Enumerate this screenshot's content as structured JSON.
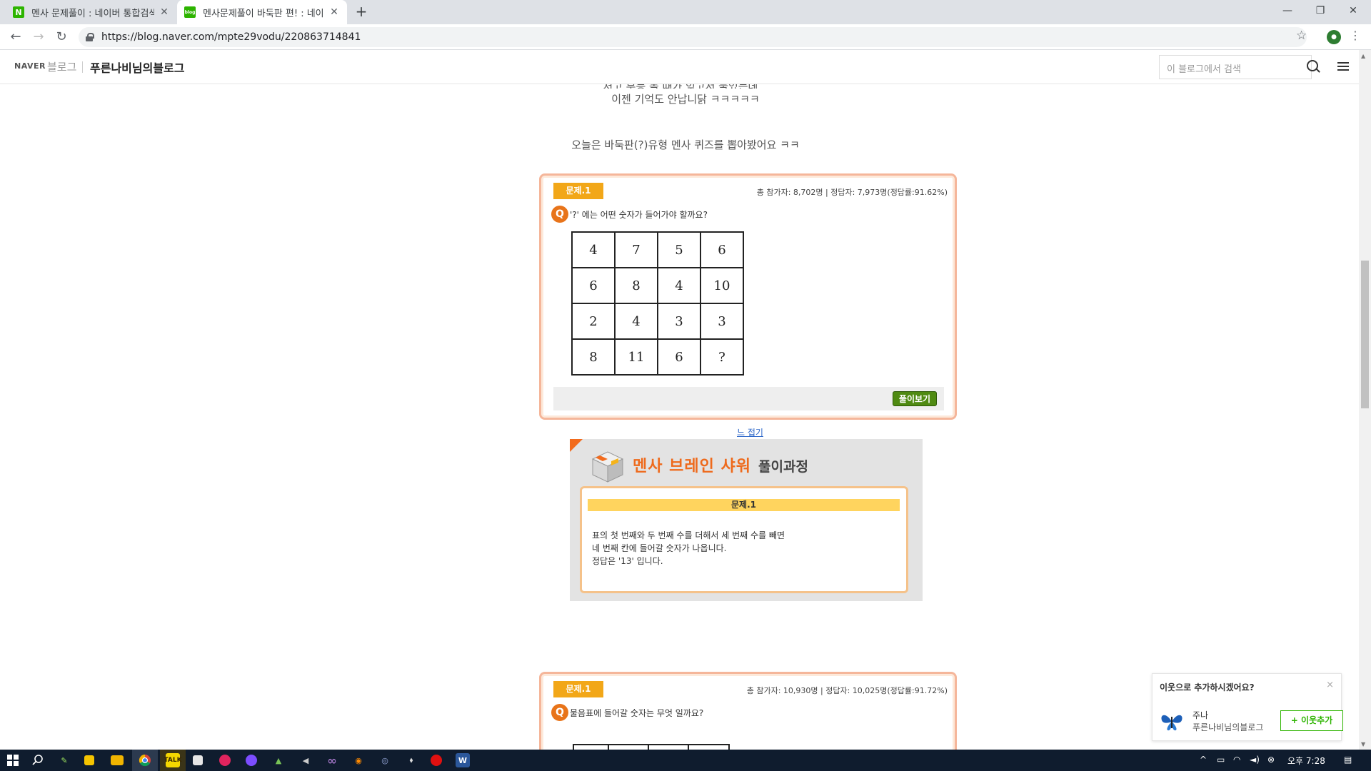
{
  "browser": {
    "tabs": [
      {
        "title": "멘사 문제풀이 : 네이버 통합검색"
      },
      {
        "title": "멘사문제풀이 바둑판 편! : 네이버"
      }
    ],
    "url": "https://blog.naver.com/mpte29vodu/220863714841"
  },
  "blog": {
    "naver": "NAVER",
    "blog_word": "블로그",
    "name": "푸른나비님의블로그",
    "search_placeholder": "이 블로그에서 검색"
  },
  "content": {
    "line_top_partial": "처고 무등 볼 때가 잊고서 불었는데...",
    "line_top2": "이젠 기억도 안납니닭 ㅋㅋㅋㅋㅋ",
    "intro": "오늘은 바둑판(?)유형 멘사 퀴즈를 뽑아봤어요 ㅋㅋ",
    "fold_link": "느 접기"
  },
  "quiz1": {
    "label": "문제.1",
    "stats": "총 참가자: 8,702명 | 정답자: 7,973명(정답률:91.62%)",
    "q_icon": "Q",
    "question": "'?' 에는 어떤 숫자가 들어가야 할까요?",
    "grid": [
      [
        "4",
        "7",
        "5",
        "6"
      ],
      [
        "6",
        "8",
        "4",
        "10"
      ],
      [
        "2",
        "4",
        "3",
        "3"
      ],
      [
        "8",
        "11",
        "6",
        "?"
      ]
    ],
    "answer_button": "풀이보기"
  },
  "solution": {
    "title": "멘사 브레인 샤워",
    "subtitle": "풀이과정",
    "header": "문제.1",
    "lines": [
      "표의 첫 번째와 두 번째 수를 더해서 세 번째 수를 빼면",
      "네 번째 칸에 들어갈 숫자가 나옵니다.",
      "정답은 '13' 입니다."
    ]
  },
  "quiz2": {
    "label": "문제.1",
    "stats": "총 참가자: 10,930명 | 정답자: 10,025명(정답률:91.72%)",
    "q_icon": "Q",
    "question": "물음표에 들어갈 숫자는 무엇 일까요?"
  },
  "neighbor": {
    "question": "이웃으로 추가하시겠어요?",
    "close": "×",
    "name": "주나",
    "blog": "푸른나비님의블로그",
    "add_button": "+ 이웃추가"
  },
  "taskbar": {
    "time": "오후 7:28"
  },
  "colors": {
    "naver_green": "#2db400",
    "quiz_border": "#f5b69a",
    "label_orange": "#f2a718",
    "answer_green": "#4f8a12"
  }
}
